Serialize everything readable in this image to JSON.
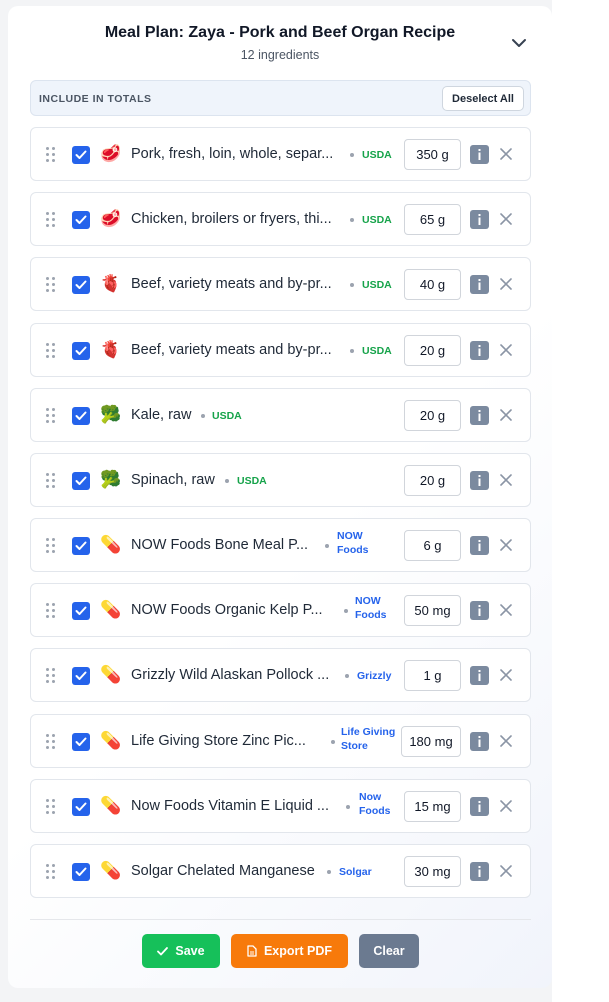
{
  "header": {
    "title": "Meal Plan: Zaya - Pork and Beef Organ Recipe",
    "subtitle": "12 ingredients",
    "collapse_icon": "chevron-down-icon"
  },
  "include_bar": {
    "label": "INCLUDE IN TOTALS",
    "deselect_label": "Deselect All"
  },
  "ingredients": [
    {
      "icon": "meat-icon",
      "emoji": "🥩",
      "name": "Pork, fresh, loin, whole, separ...",
      "source": "USDA",
      "quantity": "350 g",
      "checked": true
    },
    {
      "icon": "meat-icon",
      "emoji": "🥩",
      "name": "Chicken, broilers or fryers, thi...",
      "source": "USDA",
      "quantity": "65 g",
      "checked": true
    },
    {
      "icon": "heart-organ-icon",
      "emoji": "🫀",
      "name": "Beef, variety meats and by-pr...",
      "source": "USDA",
      "quantity": "40 g",
      "checked": true
    },
    {
      "icon": "heart-organ-icon",
      "emoji": "🫀",
      "name": "Beef, variety meats and by-pr...",
      "source": "USDA",
      "quantity": "20 g",
      "checked": true
    },
    {
      "icon": "broccoli-icon",
      "emoji": "🥦",
      "name": "Kale, raw",
      "source": "USDA",
      "quantity": "20 g",
      "checked": true
    },
    {
      "icon": "broccoli-icon",
      "emoji": "🥦",
      "name": "Spinach, raw",
      "source": "USDA",
      "quantity": "20 g",
      "checked": true
    },
    {
      "icon": "pill-icon",
      "emoji": "💊",
      "name": "NOW Foods Bone Meal P...",
      "source_line1": "NOW",
      "source_line2": "Foods",
      "quantity": "6 g",
      "checked": true
    },
    {
      "icon": "pill-icon",
      "emoji": "💊",
      "name": "NOW Foods Organic Kelp P...",
      "source_line1": "NOW",
      "source_line2": "Foods",
      "quantity": "50 mg",
      "checked": true
    },
    {
      "icon": "pill-icon",
      "emoji": "💊",
      "name": "Grizzly Wild Alaskan Pollock ...",
      "source": "Grizzly",
      "quantity": "1 g",
      "checked": true
    },
    {
      "icon": "pill-icon",
      "emoji": "💊",
      "name": "Life Giving Store Zinc Pic...",
      "source_line1": "Life Giving",
      "source_line2": "Store",
      "quantity": "180 mg",
      "checked": true
    },
    {
      "icon": "pill-icon",
      "emoji": "💊",
      "name": "Now Foods Vitamin E Liquid ...",
      "source_line1": "Now",
      "source_line2": "Foods",
      "quantity": "15 mg",
      "checked": true
    },
    {
      "icon": "pill-icon",
      "emoji": "💊",
      "name": "Solgar Chelated Manganese",
      "source": "Solgar",
      "quantity": "30 mg",
      "checked": true
    }
  ],
  "footer": {
    "save_label": "Save",
    "export_label": "Export PDF",
    "clear_label": "Clear"
  },
  "colors": {
    "checkbox": "#2563eb",
    "usda_source": "#16a34a",
    "brand_source": "#2563eb",
    "save_button": "#16c05a",
    "export_button": "#f77a0b",
    "clear_button": "#6b7a90"
  }
}
